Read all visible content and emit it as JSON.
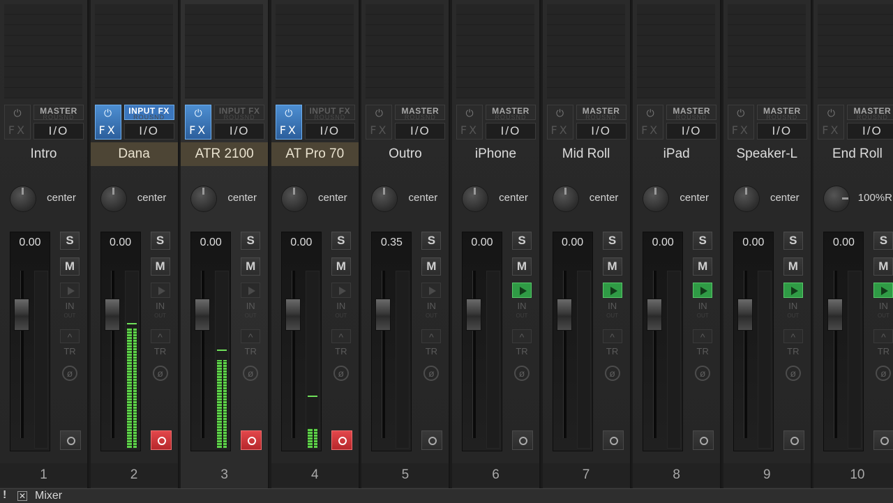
{
  "window": {
    "title": "Mixer",
    "status_symbol": "!",
    "close_glyph": "✕"
  },
  "colors": {
    "fx_on": "#4d8fd2",
    "input_fx": "#3b76bd",
    "armed_name": "#4d4535",
    "record_armed": "#d13a3f",
    "meter": "#5fd34a",
    "play_on": "#2f9b45"
  },
  "labels": {
    "power_icon": "⏻",
    "fx": "FX",
    "io": "I/O",
    "solo": "S",
    "mute": "M",
    "in": "IN",
    "out": "OUT",
    "tr": "TR",
    "phase_icon": "ø",
    "tr_icon": "^",
    "route_sub": "ROUSND"
  },
  "strips": [
    {
      "number": "1",
      "name": "Intro",
      "fx_on": false,
      "route": "MASTER",
      "route_type": "master",
      "pan": "center",
      "volume": "0.00",
      "meter_level": 0,
      "meter_peak": 0,
      "play": false,
      "record_armed": false,
      "armed": false,
      "selected": false
    },
    {
      "number": "2",
      "name": "Dana",
      "fx_on": true,
      "route": "INPUT FX",
      "route_type": "input",
      "pan": "center",
      "volume": "0.00",
      "meter_level": 0.68,
      "meter_peak": 0.7,
      "play": false,
      "record_armed": true,
      "armed": true,
      "selected": false
    },
    {
      "number": "3",
      "name": "ATR 2100",
      "fx_on": true,
      "route": "INPUT FX",
      "route_type": "dim",
      "pan": "center",
      "volume": "0.00",
      "meter_level": 0.5,
      "meter_peak": 0.55,
      "play": false,
      "record_armed": true,
      "armed": true,
      "selected": true
    },
    {
      "number": "4",
      "name": "AT Pro 70",
      "fx_on": true,
      "route": "INPUT FX",
      "route_type": "dim",
      "pan": "center",
      "volume": "0.00",
      "meter_level": 0.11,
      "meter_peak": 0.29,
      "play": false,
      "record_armed": true,
      "armed": true,
      "selected": false
    },
    {
      "number": "5",
      "name": "Outro",
      "fx_on": false,
      "route": "MASTER",
      "route_type": "master",
      "pan": "center",
      "volume": "0.35",
      "meter_level": 0,
      "meter_peak": 0,
      "play": false,
      "record_armed": false,
      "armed": false,
      "selected": false
    },
    {
      "number": "6",
      "name": "iPhone",
      "fx_on": false,
      "route": "MASTER",
      "route_type": "master",
      "pan": "center",
      "volume": "0.00",
      "meter_level": 0,
      "meter_peak": 0,
      "play": true,
      "record_armed": false,
      "armed": false,
      "selected": false
    },
    {
      "number": "7",
      "name": "Mid Roll",
      "fx_on": false,
      "route": "MASTER",
      "route_type": "master",
      "pan": "center",
      "volume": "0.00",
      "meter_level": 0,
      "meter_peak": 0,
      "play": true,
      "record_armed": false,
      "armed": false,
      "selected": false
    },
    {
      "number": "8",
      "name": "iPad",
      "fx_on": false,
      "route": "MASTER",
      "route_type": "master",
      "pan": "center",
      "volume": "0.00",
      "meter_level": 0,
      "meter_peak": 0,
      "play": true,
      "record_armed": false,
      "armed": false,
      "selected": false
    },
    {
      "number": "9",
      "name": "Speaker-L",
      "fx_on": false,
      "route": "MASTER",
      "route_type": "master",
      "pan": "center",
      "volume": "0.00",
      "meter_level": 0,
      "meter_peak": 0,
      "play": true,
      "record_armed": false,
      "armed": false,
      "selected": false
    },
    {
      "number": "10",
      "name": "End Roll",
      "fx_on": false,
      "route": "MASTER",
      "route_type": "master",
      "pan": "100%R",
      "volume": "0.00",
      "meter_level": 0,
      "meter_peak": 0,
      "play": true,
      "record_armed": false,
      "armed": false,
      "selected": false
    }
  ]
}
